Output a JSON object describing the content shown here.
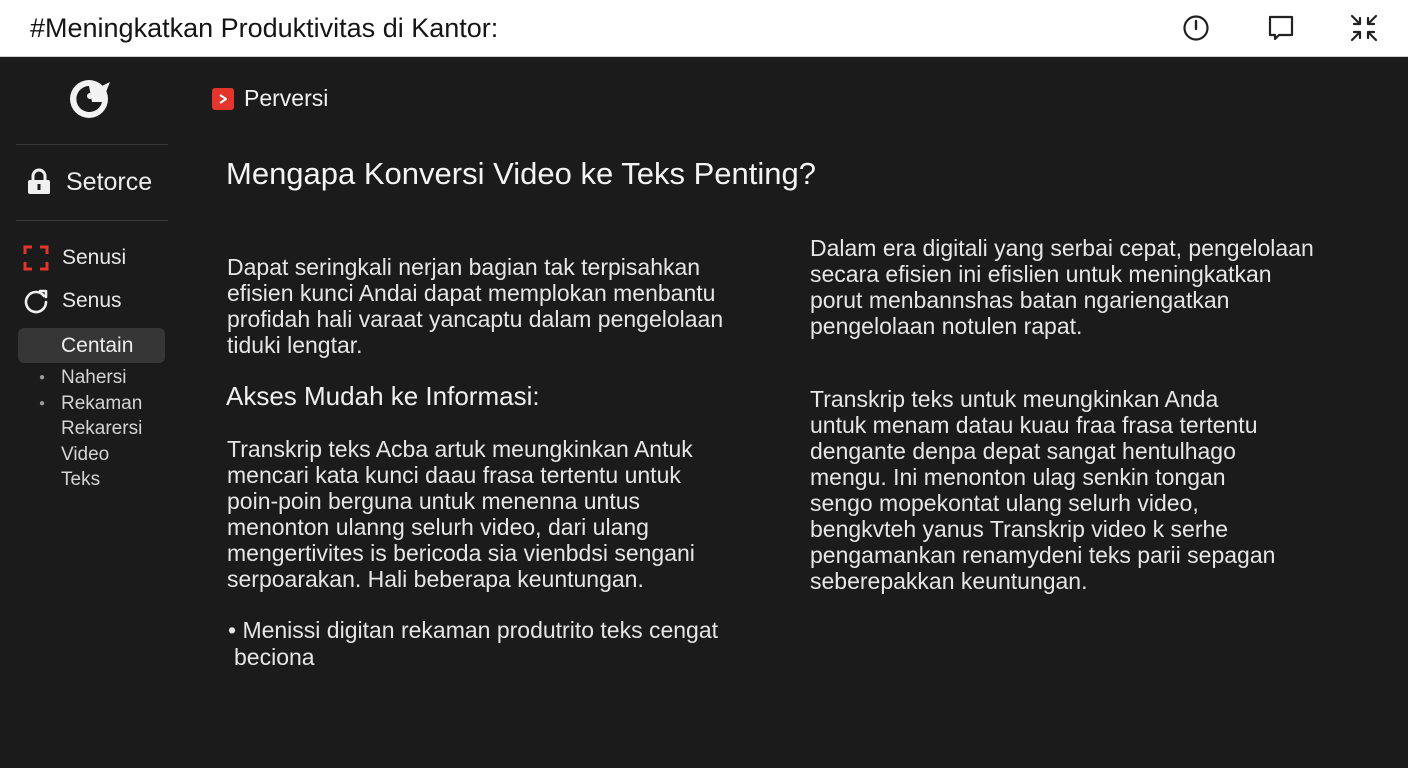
{
  "window": {
    "title": "#Meningkatkan Produktivitas di Kantor:"
  },
  "sidebar": {
    "main_item": {
      "label": "Setorce",
      "icon": "lock-icon"
    },
    "items": [
      {
        "label": "Senusi",
        "icon": "expand-corners-icon",
        "icon_color": "#e3352b"
      },
      {
        "label": "Senus",
        "icon": "refresh-icon"
      }
    ],
    "active_item": {
      "label": "Centain"
    },
    "sub_items": [
      "Nahersi",
      "Rekaman",
      "Rekarersi",
      "Video",
      "Teks"
    ]
  },
  "content": {
    "brand": "Perversi",
    "heading": "Mengapa Konversi Video ke Teks Penting?",
    "left_paragraph_1": [
      "Dapat seringkali nerjan bagian tak terpisahkan",
      "efisien kunci Andai dapat memplokan menbantu",
      "profidah hali varaat yancaptu dalam pengelolaan",
      "tiduki lengtar."
    ],
    "subheading": "Akses Mudah ke Informasi:",
    "left_paragraph_2": [
      "Transkrip teks Acba artuk meungkinkan Antuk",
      "mencari kata kunci daau frasa tertentu untuk",
      "poin-poin berguna untuk menenna untus",
      "menonton ulanng selurh video, dari ulang",
      "mengertivites is bericoda sia vienbdsi sengani",
      "serpoarakan. Hali beberapa keuntungan."
    ],
    "bullet": {
      "line1": "• Menissi digitan rekaman produtrito teks cengat",
      "line2": "beciona"
    },
    "right_paragraph_1": [
      "Dalam era digitali yang serbai cepat, pengelolaan",
      "secara efisien ini efislien untuk meningkatkan",
      "porut menbannshas batan ngariengatkan",
      "pengelolaan notulen rapat."
    ],
    "right_paragraph_2": [
      "Transkrip teks untuk meungkinkan Anda",
      "untuk menam datau kuau fraa frasa tertentu",
      "dengante denpa depat sangat hentulhago",
      "mengu. Ini menonton ulag senkin tongan",
      "sengo mopekontat ulang selurh video,",
      "bengkvteh yanus  Transkrip video k serhe",
      "pengamankan renamydeni teks parii sepagan",
      "seberepakkan keuntungan."
    ]
  },
  "colors": {
    "background": "#1b1b1b",
    "titlebar": "#ffffff",
    "accent_red": "#e3352b",
    "active_item_bg": "#363636"
  }
}
